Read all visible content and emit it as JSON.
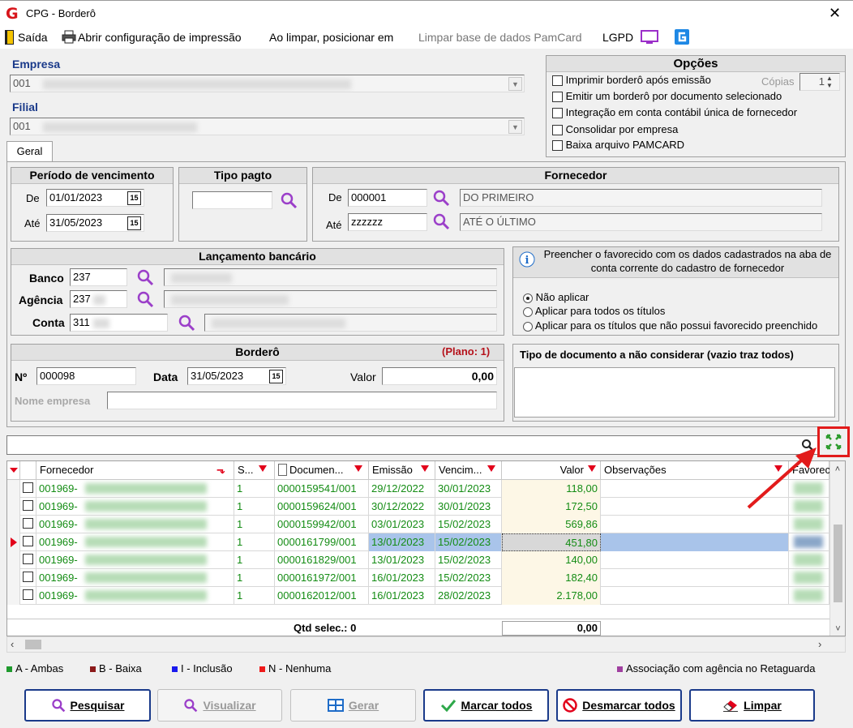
{
  "window": {
    "title": "CPG - Borderô",
    "close": "✕"
  },
  "toolbar": {
    "exit": "Saída",
    "print_config": "Abrir configuração de impressão",
    "clear_position": "Ao limpar, posicionar em",
    "clear_pamcard": "Limpar base de dados PamCard",
    "lgpd": "LGPD"
  },
  "empresa": {
    "label": "Empresa",
    "value": "001"
  },
  "filial": {
    "label": "Filial",
    "value": "001"
  },
  "tab": {
    "label": "Geral"
  },
  "opcoes": {
    "title": "Opções",
    "items": [
      "Imprimir borderô após emissão",
      "Emitir um borderô por documento selecionado",
      "Integração em conta contábil única de fornecedor",
      "Consolidar por empresa",
      "Baixa arquivo PAMCARD"
    ],
    "copias_label": "Cópias",
    "copias_value": "1"
  },
  "periodo": {
    "title": "Período de vencimento",
    "de_label": "De",
    "de_value": "01/01/2023",
    "ate_label": "Até",
    "ate_value": "31/05/2023",
    "cal_icon": "15"
  },
  "tipo_pagto": {
    "title": "Tipo pagto",
    "value": ""
  },
  "fornecedor": {
    "title": "Fornecedor",
    "de_label": "De",
    "de_code": "000001",
    "de_name": "DO PRIMEIRO",
    "ate_label": "Até",
    "ate_code": "zzzzzz",
    "ate_name": "ATÉ O ÚLTIMO"
  },
  "lancamento": {
    "title": "Lançamento bancário",
    "banco_label": "Banco",
    "banco_value": "237",
    "agencia_label": "Agência",
    "agencia_value": "237",
    "conta_label": "Conta",
    "conta_value": "311"
  },
  "favorecido": {
    "text": "Preencher o favorecido com os dados cadastrados na aba de conta corrente do cadastro de fornecedor",
    "options": [
      "Não aplicar",
      "Aplicar para todos os títulos",
      "Aplicar para os títulos que não possui favorecido preenchido"
    ]
  },
  "bordero": {
    "title": "Borderô",
    "plano": "(Plano: 1)",
    "num_label": "Nº",
    "num_value": "000098",
    "data_label": "Data",
    "data_value": "31/05/2023",
    "valor_label": "Valor",
    "valor_value": "0,00",
    "nome_label": "Nome empresa",
    "nome_value": ""
  },
  "tipo_doc": {
    "title": "Tipo de documento a não considerar (vazio traz todos)"
  },
  "grid": {
    "headers": {
      "fornecedor": "Fornecedor",
      "s": "S...",
      "documento": "Documen...",
      "emissao": "Emissão",
      "vencimento": "Vencim...",
      "valor": "Valor",
      "observacoes": "Observações",
      "favorecido": "Favorec"
    },
    "rows": [
      {
        "fornecedor": "001969-",
        "s": "1",
        "documento": "0000159541/001",
        "emissao": "29/12/2022",
        "vencimento": "30/01/2023",
        "valor": "118,00"
      },
      {
        "fornecedor": "001969-",
        "s": "1",
        "documento": "0000159624/001",
        "emissao": "30/12/2022",
        "vencimento": "30/01/2023",
        "valor": "172,50"
      },
      {
        "fornecedor": "001969-",
        "s": "1",
        "documento": "0000159942/001",
        "emissao": "03/01/2023",
        "vencimento": "15/02/2023",
        "valor": "569,86"
      },
      {
        "fornecedor": "001969-",
        "s": "1",
        "documento": "0000161799/001",
        "emissao": "13/01/2023",
        "vencimento": "15/02/2023",
        "valor": "451,80"
      },
      {
        "fornecedor": "001969-",
        "s": "1",
        "documento": "0000161829/001",
        "emissao": "13/01/2023",
        "vencimento": "15/02/2023",
        "valor": "140,00"
      },
      {
        "fornecedor": "001969-",
        "s": "1",
        "documento": "0000161972/001",
        "emissao": "16/01/2023",
        "vencimento": "15/02/2023",
        "valor": "182,40"
      },
      {
        "fornecedor": "001969-",
        "s": "1",
        "documento": "0000162012/001",
        "emissao": "16/01/2023",
        "vencimento": "28/02/2023",
        "valor": "2.178,00"
      }
    ],
    "footer_qtd": "Qtd selec.: 0",
    "footer_total": "0,00"
  },
  "legend": {
    "a": "A - Ambas",
    "b": "B - Baixa",
    "i": "I - Inclusão",
    "n": "N - Nenhuma",
    "assoc": "Associação com agência no Retaguarda",
    "colors": {
      "a": "#1f9a2e",
      "b": "#8b1a1a",
      "i": "#1a1aee",
      "n": "#ee1a1a",
      "assoc": "#a040a0"
    }
  },
  "buttons": {
    "pesquisar": "Pesquisar",
    "visualizar": "Visualizar",
    "gerar": "Gerar",
    "marcar": "Marcar todos",
    "desmarcar": "Desmarcar todos",
    "limpar": "Limpar"
  }
}
